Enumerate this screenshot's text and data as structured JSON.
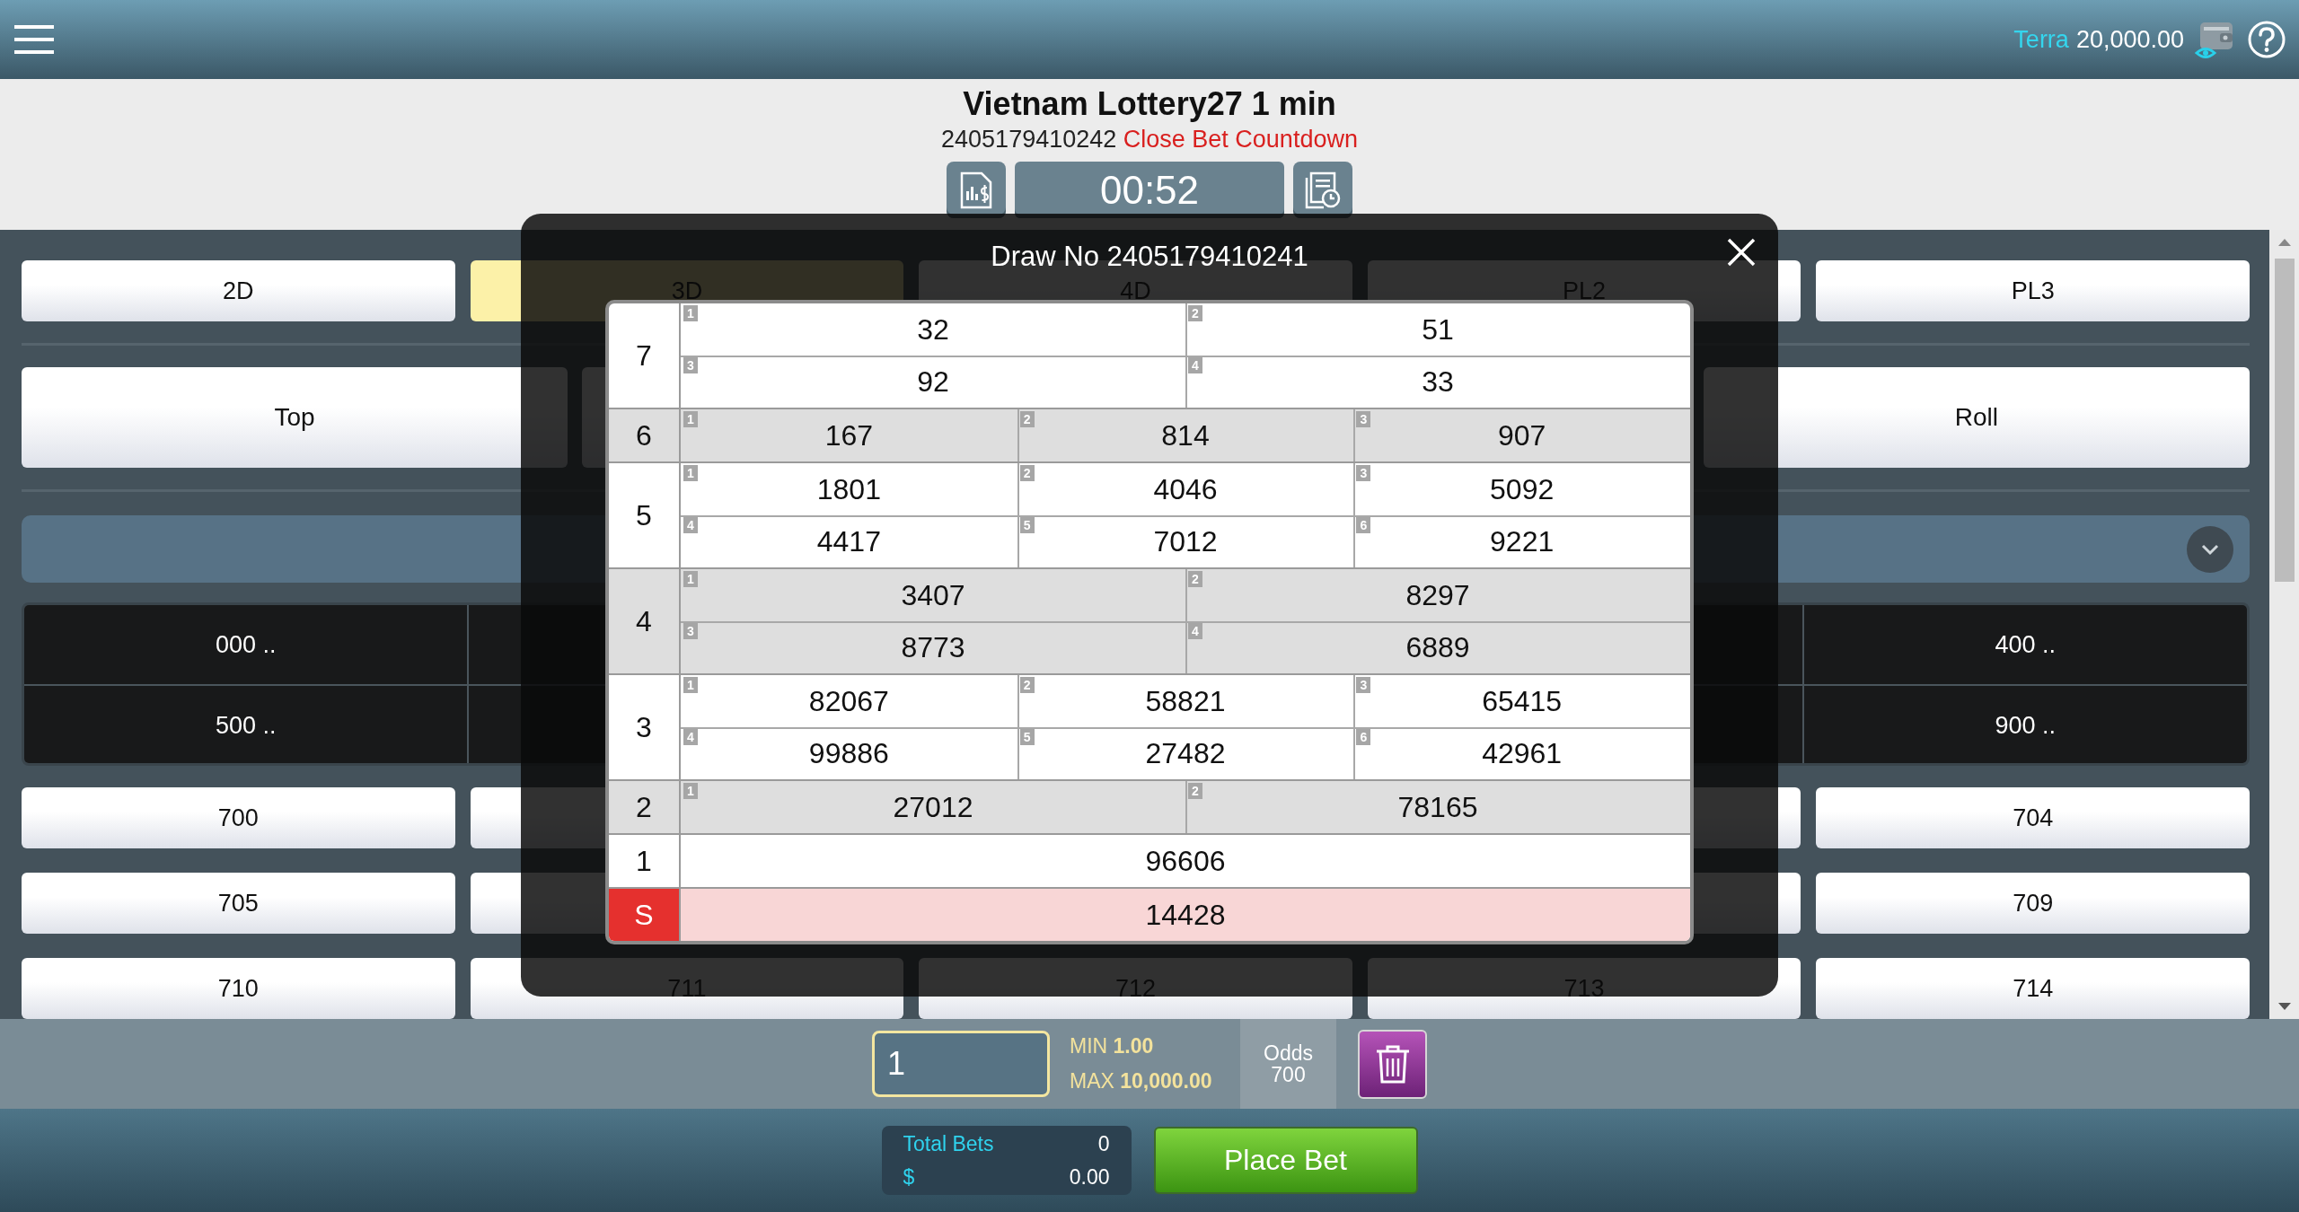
{
  "header": {
    "user": "Terra",
    "balance": "20,000.00"
  },
  "game": {
    "title": "Vietnam Lottery27 1 min",
    "draw_no": "2405179410242",
    "countdown_label": "Close Bet Countdown",
    "timer": "00:52"
  },
  "game_tabs": [
    {
      "label": "2D",
      "selected": false
    },
    {
      "label": "3D",
      "selected": true
    },
    {
      "label": "4D",
      "selected": false
    },
    {
      "label": "PL2",
      "selected": false
    },
    {
      "label": "PL3",
      "selected": false
    }
  ],
  "bet_types": [
    {
      "label": "Top"
    },
    {
      "label": "Roll"
    }
  ],
  "range_rows": [
    {
      "cells": [
        {
          "label": "000 .."
        },
        {
          "label": "400 .."
        }
      ]
    },
    {
      "cells": [
        {
          "label": "500 .."
        },
        {
          "label": "900 .."
        }
      ]
    }
  ],
  "number_rows": [
    {
      "cells": [
        {
          "label": "700"
        },
        {
          "label": "704"
        }
      ]
    },
    {
      "cells": [
        {
          "label": "705"
        },
        {
          "label": "709"
        }
      ]
    },
    {
      "cells": [
        {
          "label": "710"
        },
        {
          "label": "711"
        },
        {
          "label": "712"
        },
        {
          "label": "713"
        },
        {
          "label": "714"
        }
      ]
    }
  ],
  "stake": {
    "value": "1",
    "min_label": "MIN",
    "min": "1.00",
    "max_label": "MAX",
    "max": "10,000.00",
    "odds_label": "Odds",
    "odds": "700"
  },
  "summary": {
    "total_bets_label": "Total Bets",
    "total_bets": "0",
    "currency": "$",
    "amount": "0.00"
  },
  "place_bet": "Place Bet",
  "results": {
    "title": "Draw No 2405179410241",
    "prizes": [
      {
        "label": "7",
        "kind": "normal",
        "numbers": [
          {
            "index": "1",
            "value": "32"
          },
          {
            "index": "2",
            "value": "51"
          },
          {
            "index": "3",
            "value": "92"
          },
          {
            "index": "4",
            "value": "33"
          }
        ]
      },
      {
        "label": "6",
        "kind": "normal",
        "numbers": [
          {
            "index": "1",
            "value": "167"
          },
          {
            "index": "2",
            "value": "814"
          },
          {
            "index": "3",
            "value": "907"
          }
        ]
      },
      {
        "label": "5",
        "kind": "normal",
        "numbers": [
          {
            "index": "1",
            "value": "1801"
          },
          {
            "index": "2",
            "value": "4046"
          },
          {
            "index": "3",
            "value": "5092"
          },
          {
            "index": "4",
            "value": "4417"
          },
          {
            "index": "5",
            "value": "7012"
          },
          {
            "index": "6",
            "value": "9221"
          }
        ]
      },
      {
        "label": "4",
        "kind": "normal",
        "numbers": [
          {
            "index": "1",
            "value": "3407"
          },
          {
            "index": "2",
            "value": "8297"
          },
          {
            "index": "3",
            "value": "8773"
          },
          {
            "index": "4",
            "value": "6889"
          }
        ]
      },
      {
        "label": "3",
        "kind": "normal",
        "numbers": [
          {
            "index": "1",
            "value": "82067"
          },
          {
            "index": "2",
            "value": "58821"
          },
          {
            "index": "3",
            "value": "65415"
          },
          {
            "index": "4",
            "value": "99886"
          },
          {
            "index": "5",
            "value": "27482"
          },
          {
            "index": "6",
            "value": "42961"
          }
        ]
      },
      {
        "label": "2",
        "kind": "normal",
        "numbers": [
          {
            "index": "1",
            "value": "27012"
          },
          {
            "index": "2",
            "value": "78165"
          }
        ]
      },
      {
        "label": "1",
        "kind": "normal",
        "numbers": [
          {
            "value": "96606"
          }
        ]
      },
      {
        "label": "S",
        "kind": "special",
        "numbers": [
          {
            "value": "14428"
          }
        ]
      }
    ]
  }
}
